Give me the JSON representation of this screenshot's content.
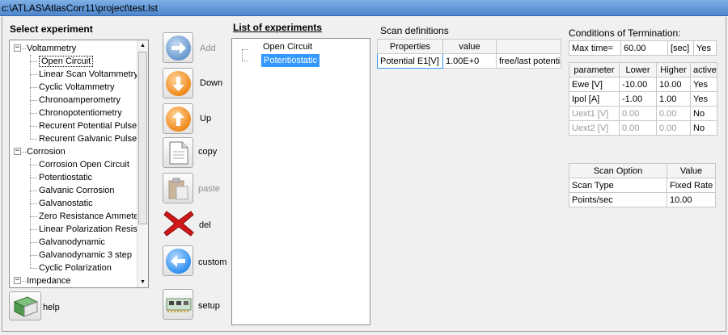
{
  "window": {
    "title": "c:\\ATLAS\\AtlasCorr11\\project\\test.lst"
  },
  "select_experiment": {
    "heading": "Select experiment",
    "groups": [
      {
        "label": "Voltammetry",
        "expander": "−",
        "items": [
          "Open Circuit",
          "Linear Scan Voltammetry",
          "Cyclic Voltammetry",
          "Chronoamperometry",
          "Chronopotentiometry",
          "Recurent Potential Pulses",
          "Recurent Galvanic Pulses"
        ]
      },
      {
        "label": "Corrosion",
        "expander": "−",
        "items": [
          "Corrosion Open Circuit",
          "Potentiostatic",
          "Galvanic Corrosion",
          "Galvanostatic",
          "Zero Resistance Ammeter",
          "Linear Polarization Resista",
          "Galvanodynamic",
          "Galvanodynamic 3 step",
          "Cyclic Polarization"
        ]
      },
      {
        "label": "Impedance",
        "expander": "−",
        "items": []
      }
    ],
    "selected": "Open Circuit"
  },
  "buttons": {
    "add": "Add",
    "down": "Down",
    "up": "Up",
    "copy": "copy",
    "paste": "paste",
    "del": "del",
    "custom": "custom",
    "setup": "setup",
    "help": "help"
  },
  "list_of_experiments": {
    "heading": "List of experiments",
    "items": [
      "Open Circuit",
      "Potentiostatic"
    ],
    "selected": "Potentiostatic"
  },
  "scan_definitions": {
    "heading": "Scan definitions",
    "columns": [
      "Properties",
      "value",
      ""
    ],
    "rows": [
      [
        "Potential E1[V]",
        "1.00E+0",
        "free/last potentia"
      ]
    ]
  },
  "termination": {
    "heading": "Conditions of Termination:",
    "max_time": {
      "label": "Max time=",
      "value": "60.00",
      "unit": "[sec]",
      "active": "Yes"
    },
    "columns": [
      "parameter",
      "Lower",
      "Higher",
      "active"
    ],
    "rows": [
      {
        "cells": [
          "Ewe [V]",
          "-10.00",
          "10.00",
          "Yes"
        ],
        "enabled": true
      },
      {
        "cells": [
          "Ipol [A]",
          "-1.00",
          "1.00",
          "Yes"
        ],
        "enabled": true
      },
      {
        "cells": [
          "Uext1 [V]",
          "0.00",
          "0.00",
          "No"
        ],
        "enabled": false
      },
      {
        "cells": [
          "Uext2 [V]",
          "0.00",
          "0.00",
          "No"
        ],
        "enabled": false
      }
    ]
  },
  "scan_option": {
    "columns": [
      "Scan Option",
      "Value"
    ],
    "rows": [
      [
        "Scan Type",
        "Fixed Rate"
      ],
      [
        "Points/sec",
        "10.00"
      ]
    ]
  },
  "colors": {
    "accent_blue": "#3399ff",
    "orange": "#f08a1c",
    "red": "#d01818",
    "title_blue": "#5b93d6"
  },
  "icons": {
    "add": "right-arrow-icon",
    "down": "down-arrow-icon",
    "up": "up-arrow-icon",
    "copy": "document-icon",
    "paste": "paste-icon",
    "del": "red-x-icon",
    "custom": "left-arrow-icon",
    "setup": "hardware-card-icon",
    "help": "book-icon"
  }
}
